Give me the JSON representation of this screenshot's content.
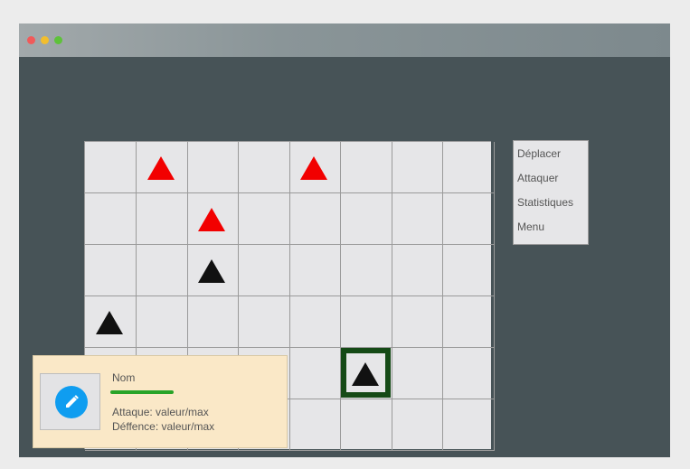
{
  "window": {
    "controls": [
      "close",
      "minimize",
      "maximize"
    ]
  },
  "board": {
    "columns": 8,
    "rows": 6,
    "units": [
      {
        "col": 1,
        "row": 0,
        "team": "enemy",
        "color": "#f20000"
      },
      {
        "col": 4,
        "row": 0,
        "team": "enemy",
        "color": "#f20000"
      },
      {
        "col": 2,
        "row": 1,
        "team": "enemy",
        "color": "#f20000"
      },
      {
        "col": 2,
        "row": 2,
        "team": "player",
        "color": "#111111"
      },
      {
        "col": 0,
        "row": 3,
        "team": "player",
        "color": "#111111"
      },
      {
        "col": 5,
        "row": 4,
        "team": "player",
        "color": "#111111",
        "selected": true
      }
    ],
    "selection_color": "#154a16"
  },
  "menu": {
    "items": [
      "Déplacer",
      "Attaquer",
      "Statistiques",
      "Menu"
    ]
  },
  "unit_panel": {
    "name": "Nom",
    "attack_line": "Attaque: valeur/max",
    "defense_line": "Déffence: valeur/max",
    "edit_icon": "pencil-icon",
    "hp_color": "#28a428"
  }
}
